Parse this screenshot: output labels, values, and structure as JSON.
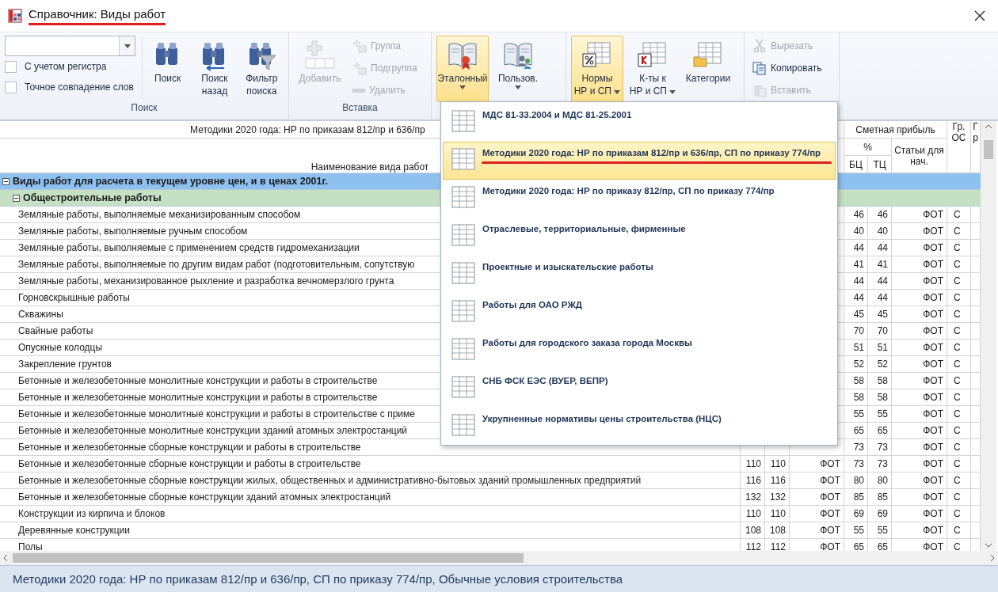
{
  "window": {
    "title": "Справочник: Виды работ",
    "underlined": true
  },
  "ribbon": {
    "groups": [
      {
        "label": "Поиск",
        "checkboxes": [
          {
            "label": "С учетом регистра",
            "checked": false
          },
          {
            "label": "Точное совпадение слов",
            "checked": false
          }
        ],
        "buttons": [
          {
            "kind": "large",
            "lines": [
              "Поиск"
            ],
            "disabled": false
          },
          {
            "kind": "large",
            "lines": [
              "Поиск",
              "назад"
            ],
            "disabled": false
          },
          {
            "kind": "large",
            "lines": [
              "Фильтр",
              "поиска"
            ],
            "disabled": false
          }
        ]
      },
      {
        "label": "Вставка",
        "buttons": [
          {
            "kind": "large",
            "lines": [
              "Добавить"
            ],
            "disabled": true
          },
          {
            "kind": "small",
            "lines": [
              "Группа"
            ],
            "disabled": true
          },
          {
            "kind": "small",
            "lines": [
              "Подгруппа"
            ],
            "disabled": true
          },
          {
            "kind": "small",
            "lines": [
              "Удалить"
            ],
            "disabled": true
          }
        ]
      },
      {
        "buttons": [
          {
            "kind": "large",
            "lines": [
              "Эталонный"
            ],
            "selected": true,
            "dropdown": true,
            "underlined": true,
            "disabled": false
          },
          {
            "kind": "large",
            "lines": [
              "Пользов."
            ],
            "selected": false,
            "dropdown": true,
            "disabled": false
          }
        ]
      },
      {
        "buttons": [
          {
            "kind": "large",
            "lines": [
              "Нормы",
              "НР и СП"
            ],
            "selected": true,
            "dropdown": true,
            "disabled": false
          },
          {
            "kind": "large",
            "lines": [
              "К-ты к",
              "НР и СП"
            ],
            "selected": false,
            "dropdown": true,
            "disabled": false
          },
          {
            "kind": "large",
            "lines": [
              "Категории"
            ],
            "selected": false,
            "disabled": false
          }
        ]
      },
      {
        "buttons": [
          {
            "kind": "small",
            "lines": [
              "Вырезать"
            ],
            "disabled": true
          },
          {
            "kind": "small",
            "lines": [
              "Копировать"
            ],
            "disabled": false
          },
          {
            "kind": "small",
            "lines": [
              "Вставить"
            ],
            "disabled": true
          }
        ]
      }
    ]
  },
  "table": {
    "header": {
      "group": "Методики 2020 года: НР по приказам 812/пр и 636/пр",
      "name": "Наименование вида работ",
      "profit": "Сметная прибыль",
      "percent": "%",
      "bc": "БЦ",
      "tc": "ТЦ",
      "articles": "Статьи для нач.",
      "gr_os": "Гр. ОС",
      "column_9": "Г р"
    },
    "rows": [
      {
        "kind": "group",
        "name": "Виды работ для расчета в текущем уровне цен, и в ценах 2001г.",
        "expanded": true
      },
      {
        "kind": "subgroup",
        "name": "Общестроительные работы",
        "expanded": true
      },
      {
        "kind": "item",
        "name": "Земляные работы, выполняемые механизированным способом",
        "bc": "46",
        "tc": "46",
        "articles": "ФОТ",
        "gr_os": "С"
      },
      {
        "kind": "item",
        "name": "Земляные работы, выполняемые ручным способом",
        "bc": "40",
        "tc": "40",
        "articles": "ФОТ",
        "gr_os": "С"
      },
      {
        "kind": "item",
        "name": "Земляные работы, выполняемые с применением средств гидромеханизации",
        "bc": "44",
        "tc": "44",
        "articles": "ФОТ",
        "gr_os": "С"
      },
      {
        "kind": "item",
        "name": "Земляные работы, выполняемые по другим видам работ (подготовительным, сопутствую",
        "bc": "41",
        "tc": "41",
        "articles": "ФОТ",
        "gr_os": "С"
      },
      {
        "kind": "item",
        "name": "Земляные работы, механизированное рыхление и разработка вечномерзлого грунта",
        "bc": "44",
        "tc": "44",
        "articles": "ФОТ",
        "gr_os": "С"
      },
      {
        "kind": "item",
        "name": "Горновскрышные работы",
        "bc": "44",
        "tc": "44",
        "articles": "ФОТ",
        "gr_os": "С"
      },
      {
        "kind": "item",
        "name": "Скважины",
        "bc": "45",
        "tc": "45",
        "articles": "ФОТ",
        "gr_os": "С"
      },
      {
        "kind": "item",
        "name": "Свайные работы",
        "bc": "70",
        "tc": "70",
        "articles": "ФОТ",
        "gr_os": "С"
      },
      {
        "kind": "item",
        "name": "Опускные колодцы",
        "bc": "51",
        "tc": "51",
        "articles": "ФОТ",
        "gr_os": "С"
      },
      {
        "kind": "item",
        "name": "Закрепление грунтов",
        "bc": "52",
        "tc": "52",
        "articles": "ФОТ",
        "gr_os": "С"
      },
      {
        "kind": "item",
        "name": "Бетонные и железобетонные монолитные конструкции и работы в строительстве",
        "bc": "58",
        "tc": "58",
        "articles": "ФОТ",
        "gr_os": "С"
      },
      {
        "kind": "item",
        "name": "Бетонные и железобетонные монолитные конструкции и работы в строительстве",
        "bc": "58",
        "tc": "58",
        "articles": "ФОТ",
        "gr_os": "С"
      },
      {
        "kind": "item",
        "name": "Бетонные и железобетонные монолитные конструкции и работы в строительстве с приме",
        "bc": "55",
        "tc": "55",
        "articles": "ФОТ",
        "gr_os": "С"
      },
      {
        "kind": "item",
        "name": "Бетонные и железобетонные монолитные конструкции зданий атомных электростанций",
        "bc": "65",
        "tc": "65",
        "articles": "ФОТ",
        "gr_os": "С"
      },
      {
        "kind": "item",
        "name": "Бетонные и железобетонные сборные конструкции и работы в строительстве",
        "bc": "73",
        "tc": "73",
        "articles": "ФОТ",
        "gr_os": "С"
      },
      {
        "kind": "item",
        "name": "Бетонные и железобетонные сборные конструкции и работы в строительстве",
        "column_2": "110",
        "column_3": "110",
        "column_4": "ФОТ",
        "bc": "73",
        "tc": "73",
        "articles": "ФОТ",
        "gr_os": "С"
      },
      {
        "kind": "item",
        "name": "Бетонные и железобетонные сборные конструкции жилых, общественных и административно-бытовых зданий промышленных предприятий",
        "column_2": "116",
        "column_3": "116",
        "column_4": "ФОТ",
        "bc": "80",
        "tc": "80",
        "articles": "ФОТ",
        "gr_os": "С"
      },
      {
        "kind": "item",
        "name": "Бетонные и железобетонные сборные конструкции зданий атомных электростанций",
        "column_2": "132",
        "column_3": "132",
        "column_4": "ФОТ",
        "bc": "85",
        "tc": "85",
        "articles": "ФОТ",
        "gr_os": "С"
      },
      {
        "kind": "item",
        "name": "Конструкции из кирпича и блоков",
        "column_2": "110",
        "column_3": "110",
        "column_4": "ФОТ",
        "bc": "69",
        "tc": "69",
        "articles": "ФОТ",
        "gr_os": "С"
      },
      {
        "kind": "item",
        "name": "Деревянные конструкции",
        "column_2": "108",
        "column_3": "108",
        "column_4": "ФОТ",
        "bc": "55",
        "tc": "55",
        "articles": "ФОТ",
        "gr_os": "С"
      },
      {
        "kind": "item",
        "name": "Полы",
        "column_2": "112",
        "column_3": "112",
        "column_4": "ФОТ",
        "bc": "65",
        "tc": "65",
        "articles": "ФОТ",
        "gr_os": "С"
      }
    ]
  },
  "menu": {
    "items": [
      {
        "label": "МДС 81-33.2004 и МДС 81-25.2001",
        "selected": false
      },
      {
        "label": "Методики 2020 года: НР по приказам 812/пр и 636/пр, СП по приказу 774/пр",
        "selected": true,
        "underlined": true
      },
      {
        "label": "Методики 2020 года: НР по приказу 812/пр, СП по приказу 774/пр",
        "selected": false
      },
      {
        "label": "Отраслевые, территориальные, фирменные",
        "selected": false
      },
      {
        "label": "Проектные и изыскательские работы",
        "selected": false
      },
      {
        "label": "Работы для ОАО РЖД",
        "selected": false
      },
      {
        "label": "Работы для городского заказа города Москвы",
        "selected": false
      },
      {
        "label": "СНБ ФСК ЕЭС (ВУЕР, ВЕПР)",
        "selected": false
      },
      {
        "label": "Укрупненные нормативы цены строительства (НЦС)",
        "selected": false
      }
    ]
  },
  "status_bar": {
    "text": "Методики 2020 года: НР по приказам 812/пр и 636/пр, СП по приказу 774/пр, Обычные условия строительства"
  }
}
